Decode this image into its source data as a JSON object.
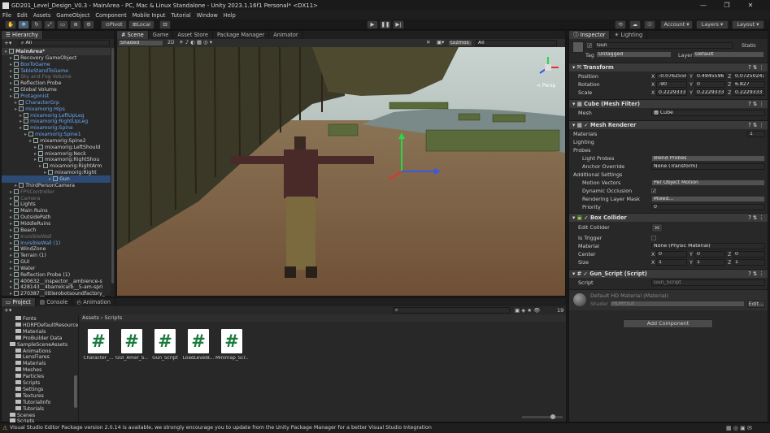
{
  "window": {
    "title": "GD201_Level_Design_V0.3 - MainArea - PC, Mac & Linux Standalone - Unity 2023.1.16f1 Personal* <DX11>",
    "minimize": "—",
    "maximize": "❐",
    "close": "✕"
  },
  "menu": [
    "File",
    "Edit",
    "Assets",
    "GameObject",
    "Component",
    "Mobile Input",
    "Tutorial",
    "Window",
    "Help"
  ],
  "toolbar": {
    "pivot": "Pivot",
    "local": "Local",
    "account": "Account",
    "layers": "Layers",
    "layout": "Layout"
  },
  "hierarchy": {
    "tab": "Hierarchy",
    "search_placeholder": "All",
    "items": [
      {
        "label": "MainArea*",
        "indent": 0,
        "style": "scene"
      },
      {
        "label": "Recovery GameObject",
        "indent": 1,
        "style": "normal"
      },
      {
        "label": "BoxToGame",
        "indent": 1,
        "style": "blue"
      },
      {
        "label": "TableStandToGame",
        "indent": 1,
        "style": "blue"
      },
      {
        "label": "Sky and Fog Volume",
        "indent": 1,
        "style": "gray"
      },
      {
        "label": "Reflection Probe",
        "indent": 1,
        "style": "normal"
      },
      {
        "label": "Global Volume",
        "indent": 1,
        "style": "normal"
      },
      {
        "label": "Protagonist",
        "indent": 1,
        "style": "blue"
      },
      {
        "label": "CharacterGrp",
        "indent": 2,
        "style": "blue"
      },
      {
        "label": "mixamorig:Hips",
        "indent": 2,
        "style": "blue"
      },
      {
        "label": "mixamorig:LeftUpLeg",
        "indent": 3,
        "style": "blue"
      },
      {
        "label": "mixamorig:RightUpLeg",
        "indent": 3,
        "style": "blue"
      },
      {
        "label": "mixamorig:Spine",
        "indent": 3,
        "style": "blue"
      },
      {
        "label": "mixamorig:Spine1",
        "indent": 4,
        "style": "blue"
      },
      {
        "label": "mixamorig:Spine2",
        "indent": 5,
        "style": "normal"
      },
      {
        "label": "mixamorig:LeftShould",
        "indent": 6,
        "style": "normal"
      },
      {
        "label": "mixamorig:Neck",
        "indent": 6,
        "style": "normal"
      },
      {
        "label": "mixamorig:RightShou",
        "indent": 6,
        "style": "normal"
      },
      {
        "label": "mixamorig:RightArm",
        "indent": 7,
        "style": "normal"
      },
      {
        "label": "mixamorig:Right",
        "indent": 8,
        "style": "normal"
      },
      {
        "label": "Gun",
        "indent": 9,
        "style": "selected"
      },
      {
        "label": "ThirdPersonCamera",
        "indent": 2,
        "style": "normal"
      },
      {
        "label": "FPSController",
        "indent": 1,
        "style": "gray"
      },
      {
        "label": "Camera",
        "indent": 1,
        "style": "gray"
      },
      {
        "label": "Lights",
        "indent": 1,
        "style": "normal"
      },
      {
        "label": "Main Ruins",
        "indent": 1,
        "style": "normal"
      },
      {
        "label": "OutsidePath",
        "indent": 1,
        "style": "normal"
      },
      {
        "label": "MiddleRuins",
        "indent": 1,
        "style": "normal"
      },
      {
        "label": "Beach",
        "indent": 1,
        "style": "normal"
      },
      {
        "label": "InvisibleWall",
        "indent": 1,
        "style": "gray"
      },
      {
        "label": "InvisibleWall (1)",
        "indent": 1,
        "style": "blue"
      },
      {
        "label": "WindZone",
        "indent": 1,
        "style": "normal"
      },
      {
        "label": "Terrain (1)",
        "indent": 1,
        "style": "normal"
      },
      {
        "label": "GUI",
        "indent": 1,
        "style": "normal"
      },
      {
        "label": "Water",
        "indent": 1,
        "style": "normal"
      },
      {
        "label": "Reflection Probe (1)",
        "indent": 1,
        "style": "normal"
      },
      {
        "label": "400632__inspector__ambience-s",
        "indent": 1,
        "style": "normal"
      },
      {
        "label": "428143__4barrelcarb__5-am-spri",
        "indent": 1,
        "style": "normal"
      },
      {
        "label": "270387__littlerobotsoundfactory_",
        "indent": 1,
        "style": "normal"
      }
    ]
  },
  "scene": {
    "tabs": [
      "Scene",
      "Game",
      "Asset Store",
      "Package Manager",
      "Animator"
    ],
    "shading": "Shaded",
    "gizmos": "Gizmos",
    "search_placeholder": "All",
    "two_d": "2D",
    "persp": "< Persp"
  },
  "project": {
    "tabs": [
      "Project",
      "Console",
      "Animation"
    ],
    "breadcrumb": [
      "Assets",
      "Scripts"
    ],
    "folders": [
      {
        "label": "Fonts",
        "indent": 1
      },
      {
        "label": "HDRPDefaultResource",
        "indent": 1
      },
      {
        "label": "Materials",
        "indent": 1
      },
      {
        "label": "ProBuilder Data",
        "indent": 1
      },
      {
        "label": "SampleSceneAssets",
        "indent": 0
      },
      {
        "label": "Animations",
        "indent": 1
      },
      {
        "label": "LensFlares",
        "indent": 1
      },
      {
        "label": "Materials",
        "indent": 1
      },
      {
        "label": "Meshes",
        "indent": 1
      },
      {
        "label": "Particles",
        "indent": 1
      },
      {
        "label": "Scripts",
        "indent": 1
      },
      {
        "label": "Settings",
        "indent": 1
      },
      {
        "label": "Textures",
        "indent": 1
      },
      {
        "label": "TutorialInfo",
        "indent": 1
      },
      {
        "label": "Tutorials",
        "indent": 1
      },
      {
        "label": "Scenes",
        "indent": 0
      },
      {
        "label": "Scripts",
        "indent": 0
      }
    ],
    "assets": [
      "Character_...",
      "GUI_Amer_S...",
      "Gun_Script",
      "LoadLevelB...",
      "Minimap_Scr..."
    ],
    "asset_glyph": "#",
    "count": "19"
  },
  "inspector": {
    "tabs": [
      "Inspector",
      "Lighting"
    ],
    "object_name": "Gun",
    "static_label": "Static",
    "tag_label": "Tag",
    "tag_value": "Untagged",
    "layer_label": "Layer",
    "layer_value": "Default",
    "transform": {
      "title": "Transform",
      "position_label": "Position",
      "rotation_label": "Rotation",
      "scale_label": "Scale",
      "position": [
        "-0.07625589",
        "0.4945596",
        "0.07250243"
      ],
      "rotation": [
        "-90",
        "0",
        "6.827"
      ],
      "scale": [
        "0.2229333",
        "0.2229333",
        "0.2229333"
      ]
    },
    "mesh_filter": {
      "title": "Cube (Mesh Filter)",
      "mesh_label": "Mesh",
      "mesh_value": "Cube"
    },
    "mesh_renderer": {
      "title": "Mesh Renderer",
      "materials": "Materials",
      "materials_count": "1",
      "lighting": "Lighting",
      "probes": "Probes",
      "light_probes_label": "Light Probes",
      "light_probes_value": "Blend Probes",
      "anchor_label": "Anchor Override",
      "anchor_value": "None (Transform)",
      "additional": "Additional Settings",
      "motion_label": "Motion Vectors",
      "motion_value": "Per Object Motion",
      "dyn_occ_label": "Dynamic Occlusion",
      "rlm_label": "Rendering Layer Mask",
      "rlm_value": "Mixed...",
      "priority_label": "Priority",
      "priority_value": "0"
    },
    "box_collider": {
      "title": "Box Collider",
      "edit_label": "Edit Collider",
      "trigger_label": "Is Trigger",
      "material_label": "Material",
      "material_value": "None (Physic Material)",
      "center_label": "Center",
      "center": [
        "0",
        "0",
        "0"
      ],
      "size_label": "Size",
      "size": [
        "1",
        "1",
        "1"
      ]
    },
    "gun_script": {
      "title": "Gun_Script (Script)",
      "script_label": "Script",
      "script_value": "Gun_Script"
    },
    "material": {
      "name": "Default HD Material (Material)",
      "shader_label": "Shader",
      "shader_value": "HDRP/Lit",
      "edit": "Edit..."
    },
    "add_component": "Add Component"
  },
  "status": {
    "message": "Visual Studio Editor Package version 2.0.14 is available, we strongly encourage you to update from the Unity Package Manager for a better Visual Studio Integration"
  },
  "colors": {
    "accent": "#2c5d87",
    "warning": "#e6b020",
    "selected": "#2c4a73"
  }
}
